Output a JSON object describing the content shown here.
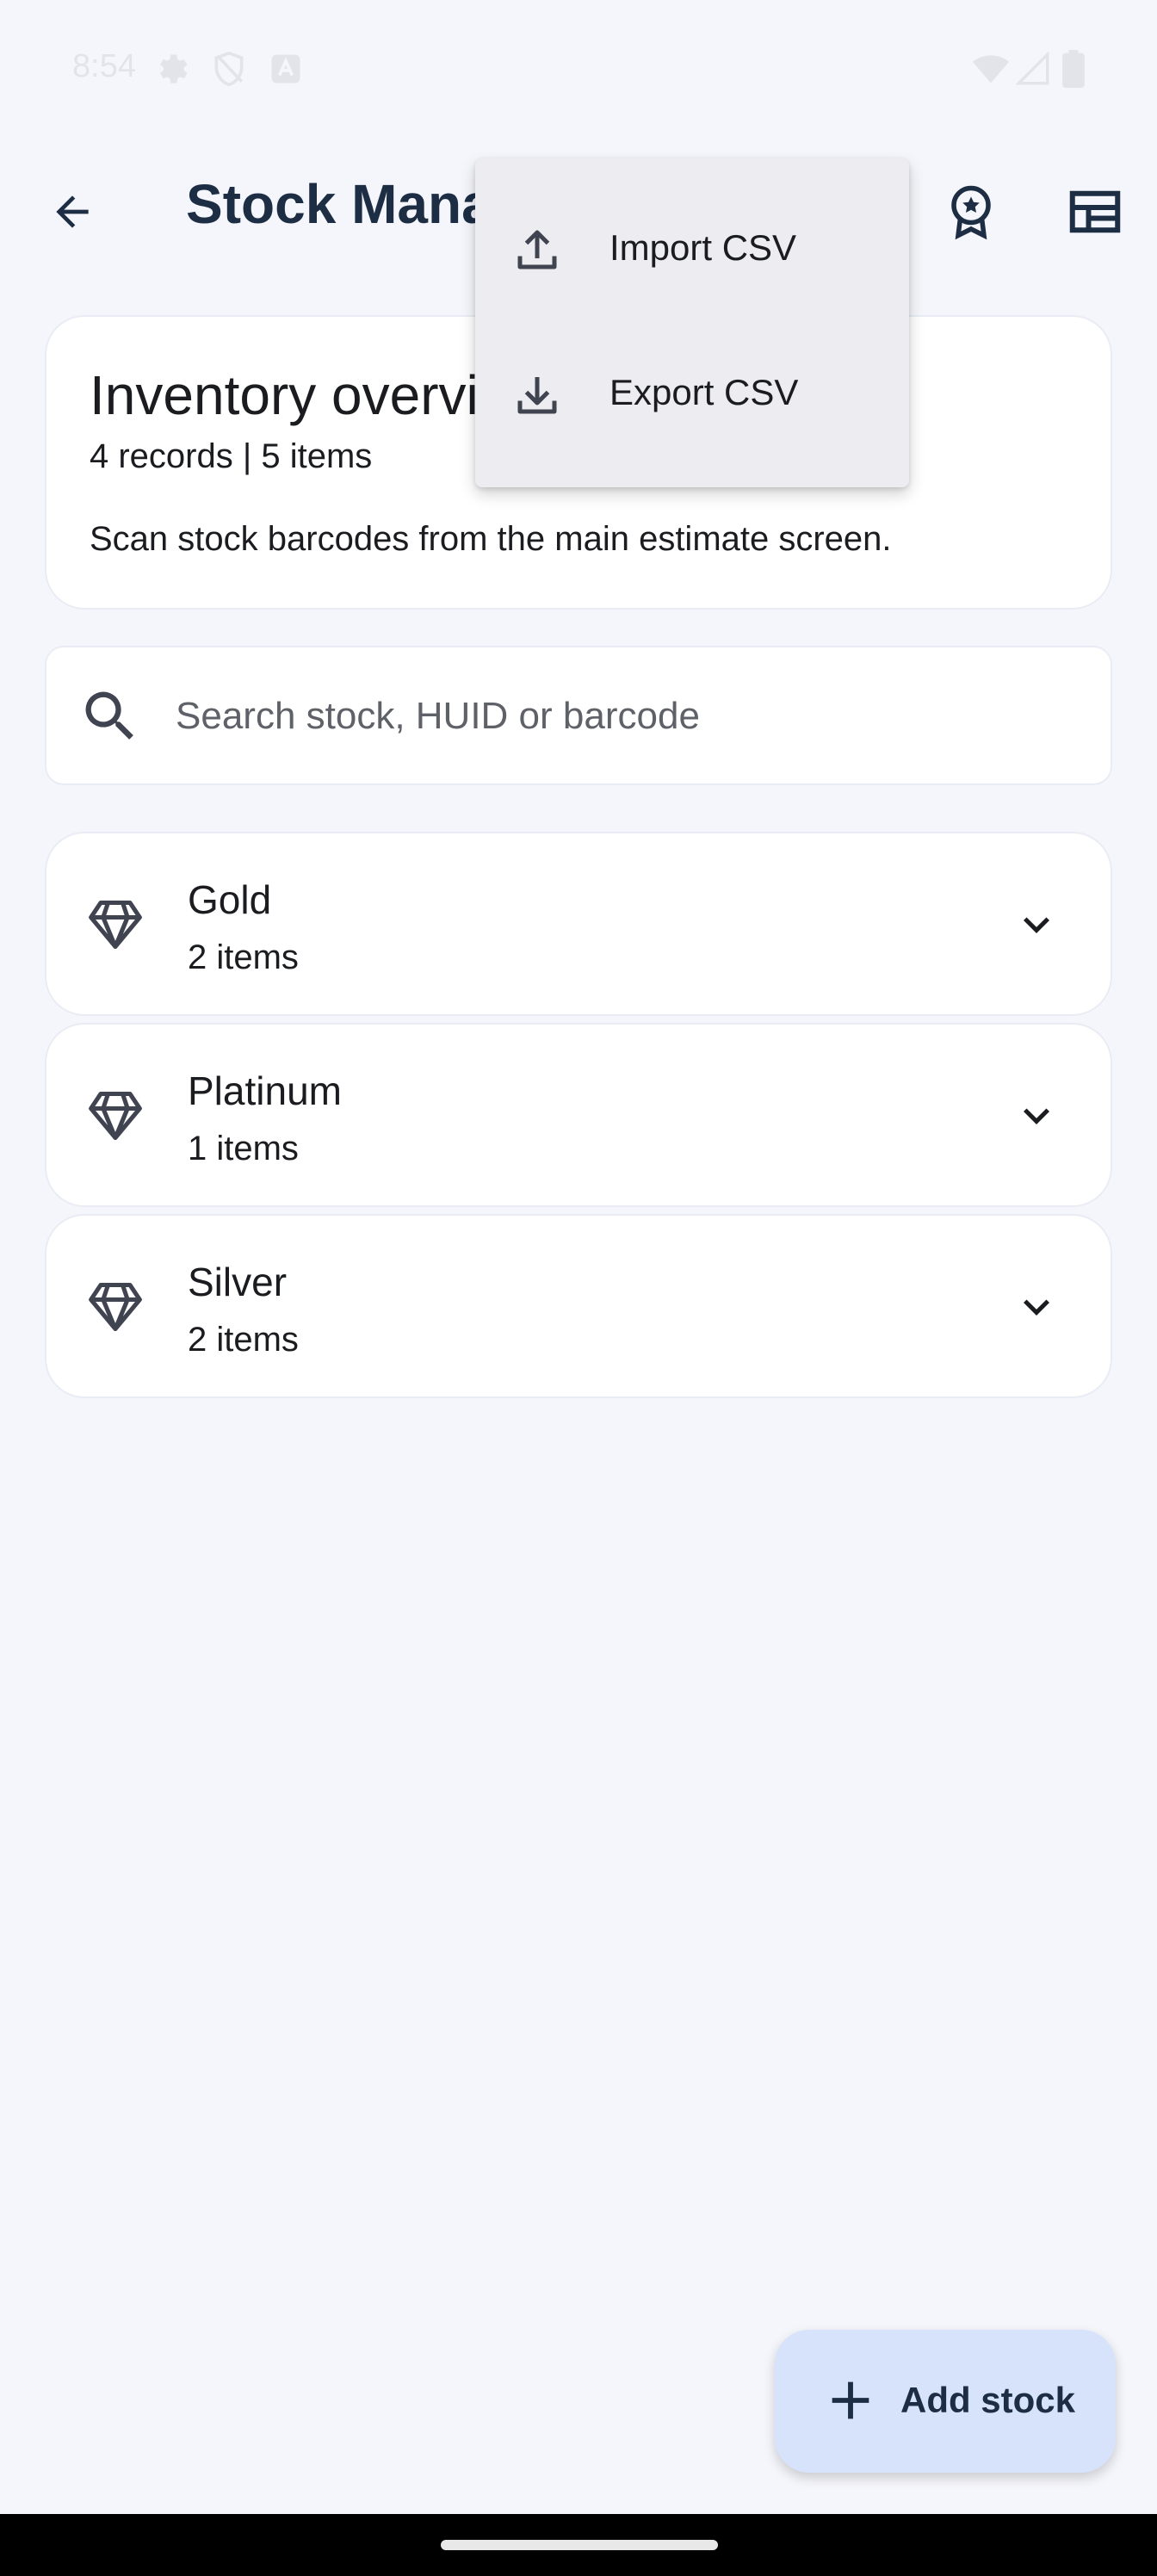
{
  "status_bar": {
    "time": "8:54",
    "left_icons": [
      "settings-icon",
      "shield-icon",
      "app-notification-icon"
    ],
    "right_icons": [
      "wifi-icon",
      "cellular-signal-icon",
      "battery-icon"
    ]
  },
  "app_bar": {
    "title": "Stock Management",
    "back_icon": "arrow-back-icon",
    "actions": [
      "award-badge-icon",
      "dashboard-table-icon"
    ]
  },
  "overflow_menu": {
    "items": [
      {
        "label": "Import CSV",
        "icon": "upload-icon"
      },
      {
        "label": "Export CSV",
        "icon": "download-icon"
      }
    ]
  },
  "overview": {
    "title": "Inventory overview",
    "summary": "4 records | 5 items",
    "hint": "Scan stock barcodes from the main estimate screen."
  },
  "search": {
    "placeholder": "Search stock, HUID or barcode",
    "value": ""
  },
  "categories": [
    {
      "name": "Gold",
      "count": "2 items",
      "icon": "diamond-icon"
    },
    {
      "name": "Platinum",
      "count": "1 items",
      "icon": "diamond-icon"
    },
    {
      "name": "Silver",
      "count": "2 items",
      "icon": "diamond-icon"
    }
  ],
  "fab": {
    "label": "Add stock",
    "icon": "plus-icon"
  },
  "colors": {
    "background": "#f5f6fb",
    "title": "#1c2d44",
    "fab_background": "#d6e3fb",
    "menu_background": "#ececf1"
  }
}
